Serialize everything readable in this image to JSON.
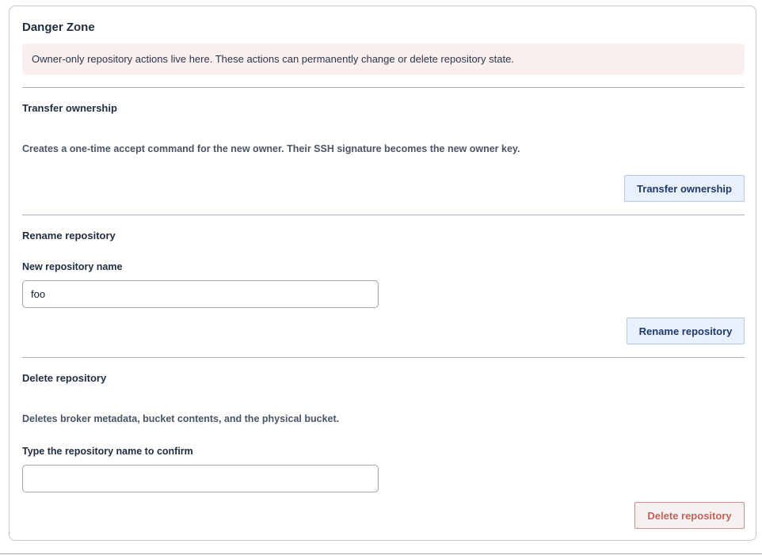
{
  "panel": {
    "title": "Danger Zone",
    "warning": "Owner-only repository actions live here. These actions can permanently change or delete repository state."
  },
  "transfer": {
    "title": "Transfer ownership",
    "description": "Creates a one-time accept command for the new owner. Their SSH signature becomes the new owner key.",
    "button_label": "Transfer ownership"
  },
  "rename": {
    "title": "Rename repository",
    "field_label": "New repository name",
    "field_value": "foo",
    "button_label": "Rename repository"
  },
  "delete": {
    "title": "Delete repository",
    "description": "Deletes broker metadata, bucket contents, and the physical bucket.",
    "field_label": "Type the repository name to confirm",
    "field_value": "",
    "button_label": "Delete repository"
  }
}
